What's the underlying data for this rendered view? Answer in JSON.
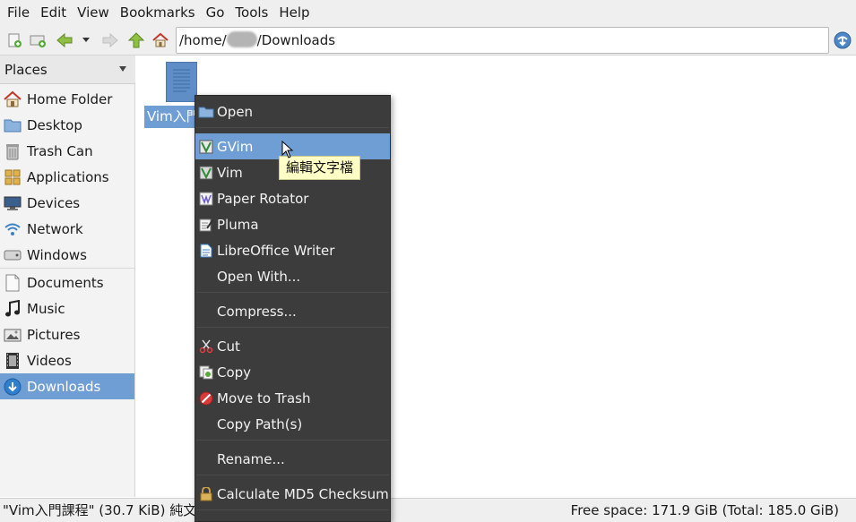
{
  "menubar": {
    "items": [
      "File",
      "Edit",
      "View",
      "Bookmarks",
      "Go",
      "Tools",
      "Help"
    ]
  },
  "location": {
    "prefix": "/home/",
    "suffix": "/Downloads"
  },
  "sidebar": {
    "header": "Places",
    "items": [
      {
        "label": "Home Folder",
        "icon": "home-icon"
      },
      {
        "label": "Desktop",
        "icon": "desktop-icon"
      },
      {
        "label": "Trash Can",
        "icon": "trash-icon"
      },
      {
        "label": "Applications",
        "icon": "applications-icon"
      },
      {
        "label": "Devices",
        "icon": "devices-icon"
      },
      {
        "label": "Network",
        "icon": "network-icon"
      },
      {
        "label": "Windows",
        "icon": "drive-icon"
      },
      {
        "label": "Documents",
        "icon": "documents-icon"
      },
      {
        "label": "Music",
        "icon": "music-icon"
      },
      {
        "label": "Pictures",
        "icon": "pictures-icon"
      },
      {
        "label": "Videos",
        "icon": "videos-icon"
      },
      {
        "label": "Downloads",
        "icon": "downloads-icon"
      }
    ],
    "active": "Downloads"
  },
  "file": {
    "name": "Vim入門課程"
  },
  "context_menu": {
    "open": "Open",
    "gvim": "GVim",
    "vim": "Vim",
    "paper_rotator": "Paper Rotator",
    "pluma": "Pluma",
    "libreoffice_writer": "LibreOffice Writer",
    "open_with": "Open With...",
    "compress": "Compress...",
    "cut": "Cut",
    "copy": "Copy",
    "move_to_trash": "Move to Trash",
    "copy_paths": "Copy Path(s)",
    "rename": "Rename...",
    "calculate_md5": "Calculate MD5 Checksum"
  },
  "tooltip": "編輯文字檔",
  "statusbar": {
    "left": "\"Vim入門課程\" (30.7 KiB) 純文字",
    "right": "Free space: 171.9 GiB (Total: 185.0 GiB)"
  },
  "colors": {
    "selection": "#6f9ed4",
    "menu_bg": "#3c3c3c",
    "tooltip_bg": "#ffffc6"
  }
}
